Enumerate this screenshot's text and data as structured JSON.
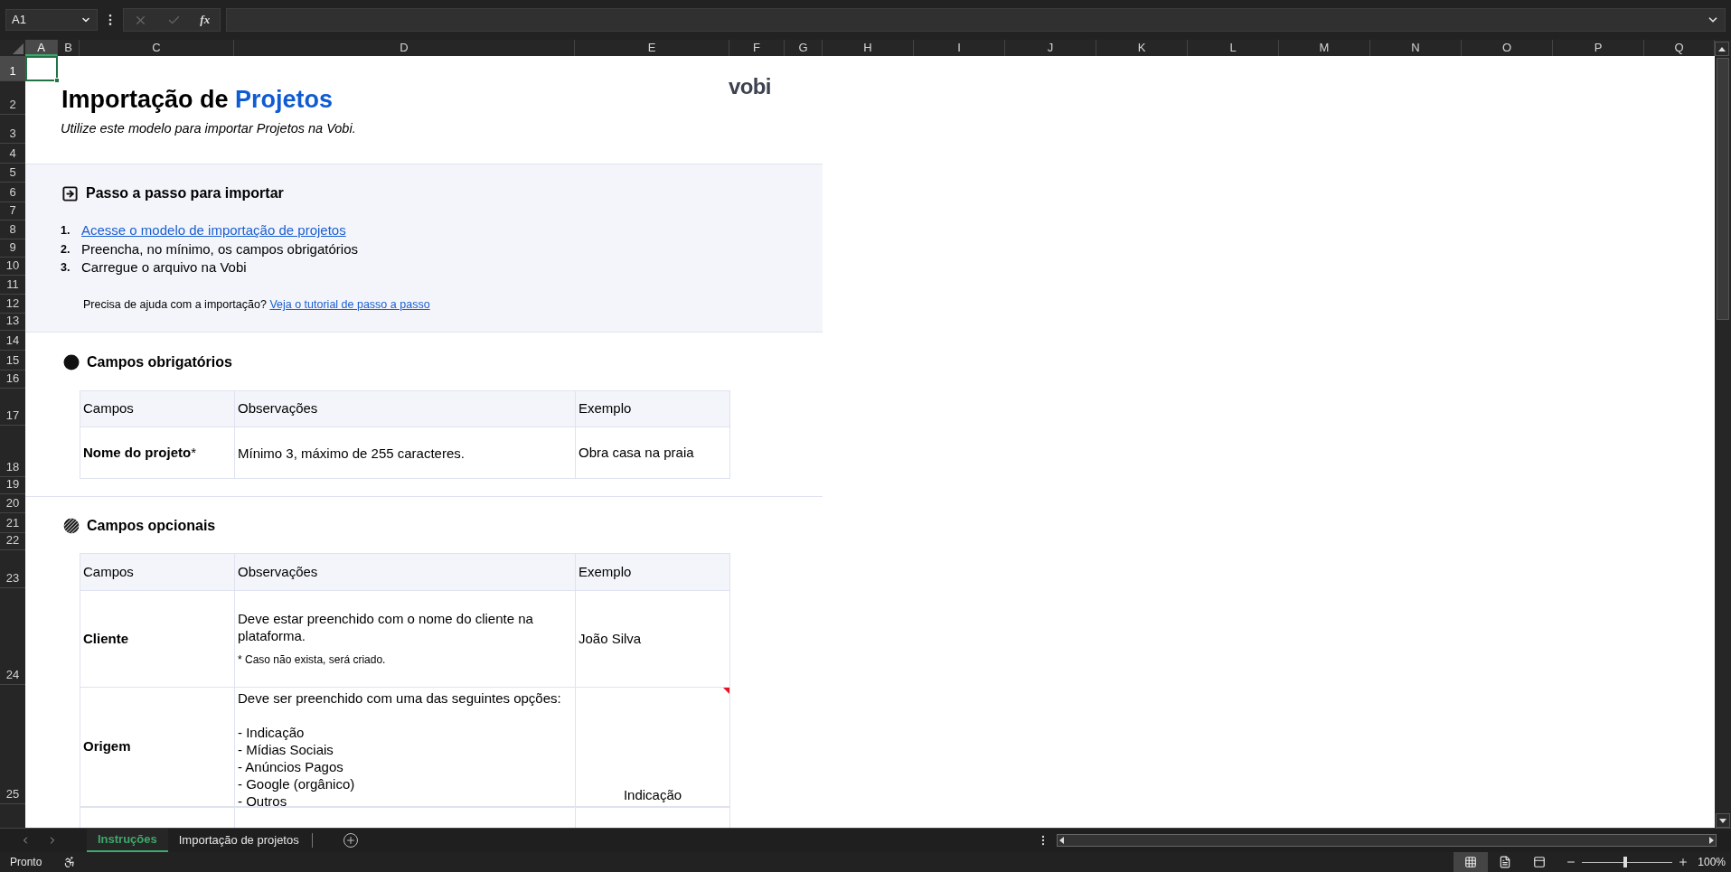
{
  "toolbar": {
    "name_box": "A1",
    "function_button": "fx"
  },
  "column_headers": [
    {
      "label": "A",
      "selected": true
    },
    {
      "label": "B",
      "selected": false
    },
    {
      "label": "C",
      "selected": false
    },
    {
      "label": "D",
      "selected": false
    },
    {
      "label": "E",
      "selected": false
    },
    {
      "label": "F",
      "selected": false
    },
    {
      "label": "G",
      "selected": false
    },
    {
      "label": "H",
      "selected": false
    },
    {
      "label": "I",
      "selected": false
    },
    {
      "label": "J",
      "selected": false
    },
    {
      "label": "K",
      "selected": false
    },
    {
      "label": "L",
      "selected": false
    },
    {
      "label": "M",
      "selected": false
    },
    {
      "label": "N",
      "selected": false
    },
    {
      "label": "O",
      "selected": false
    },
    {
      "label": "P",
      "selected": false
    },
    {
      "label": "Q",
      "selected": false
    }
  ],
  "row_headers": [
    {
      "label": "1",
      "selected": true
    },
    {
      "label": "2",
      "selected": false
    },
    {
      "label": "3",
      "selected": false
    },
    {
      "label": "4",
      "selected": false
    },
    {
      "label": "5",
      "selected": false
    },
    {
      "label": "6",
      "selected": false
    },
    {
      "label": "7",
      "selected": false
    },
    {
      "label": "8",
      "selected": false
    },
    {
      "label": "9",
      "selected": false
    },
    {
      "label": "10",
      "selected": false
    },
    {
      "label": "11",
      "selected": false
    },
    {
      "label": "12",
      "selected": false
    },
    {
      "label": "13",
      "selected": false
    },
    {
      "label": "14",
      "selected": false
    },
    {
      "label": "15",
      "selected": false
    },
    {
      "label": "16",
      "selected": false
    },
    {
      "label": "17",
      "selected": false
    },
    {
      "label": "18",
      "selected": false
    },
    {
      "label": "19",
      "selected": false
    },
    {
      "label": "20",
      "selected": false
    },
    {
      "label": "21",
      "selected": false
    },
    {
      "label": "22",
      "selected": false
    },
    {
      "label": "23",
      "selected": false
    },
    {
      "label": "24",
      "selected": false
    },
    {
      "label": "25",
      "selected": false
    }
  ],
  "document": {
    "title": "Importação de",
    "title_highlight": "Projetos",
    "logo": "vobi",
    "subtitle": "Utilize este modelo para importar Projetos na Vobi.",
    "steps_section": {
      "heading": "Passo a passo para importar",
      "steps": [
        {
          "number": "1.",
          "text": "Acesse o modelo de importação de projetos",
          "kind": "link"
        },
        {
          "number": "2.",
          "text": "Preencha, no mínimo, os campos obrigatórios",
          "kind": "text"
        },
        {
          "number": "3.",
          "text": "Carregue o arquivo na Vobi",
          "kind": "text"
        }
      ],
      "help_text": "Precisa de ajuda com a importação?",
      "help_link": "Veja o tutorial de passo a passo"
    },
    "sections": [
      {
        "heading": "Campos obrigatórios",
        "kind": "required",
        "table": {
          "columns": [
            "Campos",
            "Observações",
            "Exemplo"
          ],
          "rows": [
            {
              "field": "Nome do projeto",
              "asterisk": "*",
              "observation": "Mínimo 3, máximo de 255 caracteres.",
              "example": "Obra casa na praia",
              "has_comment": false
            }
          ]
        }
      },
      {
        "heading": "Campos opcionais",
        "kind": "optional",
        "table": {
          "columns": [
            "Campos",
            "Observações",
            "Exemplo"
          ],
          "rows": [
            {
              "field": "Cliente",
              "observation": "Deve estar preenchido com o nome do cliente na plataforma.",
              "footnote": "* Caso não exista, será criado.",
              "example": "João Silva",
              "has_comment": false
            },
            {
              "field": "Origem",
              "observation": "Deve ser preenchido com uma das seguintes opções:",
              "options": [
                "- Indicação",
                "- Mídias Sociais",
                "- Anúncios Pagos",
                "- Google (orgânico)",
                "- Outros"
              ],
              "example": "Indicação",
              "has_comment": true
            }
          ]
        }
      }
    ]
  },
  "sheet_tabs": [
    {
      "label": "Instruções",
      "selected": true
    },
    {
      "label": "Importação de projetos",
      "selected": false
    }
  ],
  "status_bar": {
    "status": "Pronto",
    "views": [
      {
        "kind": "normal",
        "selected": true
      },
      {
        "kind": "page_layout",
        "selected": false
      },
      {
        "kind": "page_break",
        "selected": false
      }
    ],
    "zoom_slider": {
      "level": 0.48
    },
    "zoom": "100%"
  }
}
